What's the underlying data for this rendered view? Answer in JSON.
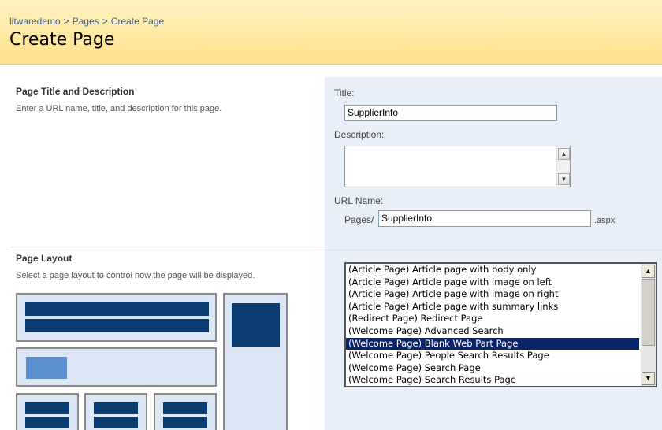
{
  "breadcrumb": {
    "site": "litwaredemo",
    "pages": "Pages",
    "current": "Create Page",
    "separator": ">"
  },
  "page_title": "Create Page",
  "sections": {
    "title_desc": {
      "heading": "Page Title and Description",
      "description": "Enter a URL name, title, and description for this page."
    },
    "layout": {
      "heading": "Page Layout",
      "description": "Select a page layout to control how the page will be displayed."
    }
  },
  "form": {
    "title_label": "Title:",
    "title_value": "SupplierInfo",
    "description_label": "Description:",
    "description_value": "",
    "url_label": "URL Name:",
    "url_prefix": "Pages/",
    "url_value": "SupplierInfo",
    "url_suffix": ".aspx"
  },
  "layout_list": {
    "items": [
      "(Article Page) Article page with body only",
      "(Article Page) Article page with image on left",
      "(Article Page) Article page with image on right",
      "(Article Page) Article page with summary links",
      "(Redirect Page) Redirect Page",
      "(Welcome Page) Advanced Search",
      "(Welcome Page) Blank Web Part Page",
      "(Welcome Page) People Search Results Page",
      "(Welcome Page) Search Page",
      "(Welcome Page) Search Results Page"
    ],
    "selected_index": 6
  },
  "icons": {
    "scroll_up": "up-arrow-icon",
    "scroll_down": "down-arrow-icon"
  },
  "colors": {
    "header_top": "#fff4c2",
    "header_bottom": "#ffe08a",
    "panel": "#e9eff9",
    "layout_block": "#0b3c71",
    "selection": "#0a246a"
  }
}
